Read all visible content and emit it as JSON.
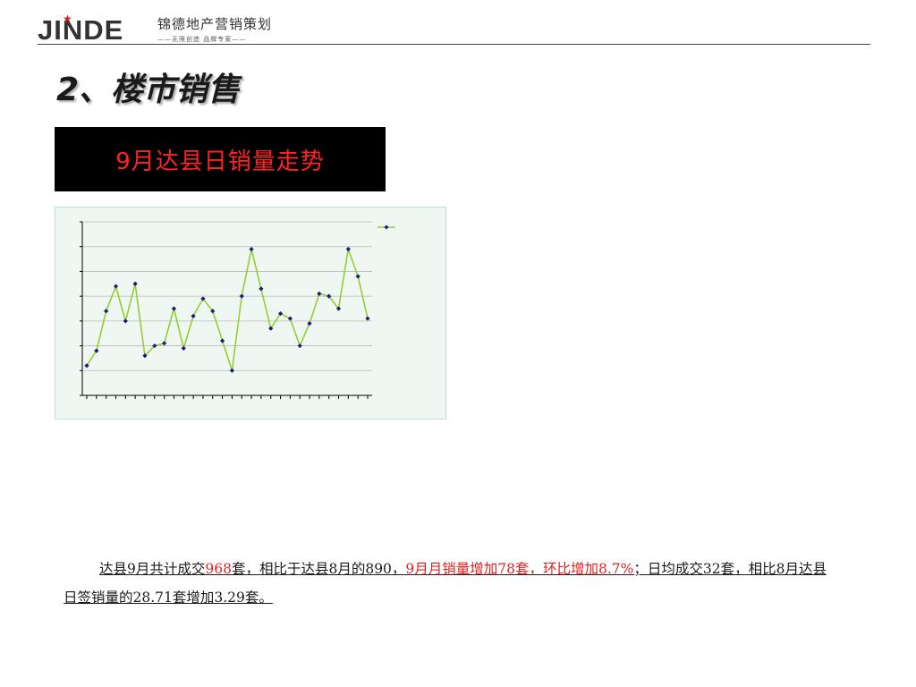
{
  "header": {
    "logo_wordmark": "JINDE",
    "company_name": "锦德地产营销策划",
    "slogan": "——无限创造 品牌专家——"
  },
  "slide": {
    "section_title": "2、楼市销售",
    "chart_title": "9月达县日销量走势"
  },
  "summary": {
    "part1": "达县9月共计成交",
    "total": "968",
    "part2": "套，相比于达县8月的890，",
    "highlight": "9月月销量增加78套，环比增加8.7%",
    "part3": "；日均成交32套，相比8月达县日签销量的28.71套增加3.29套。"
  },
  "colors": {
    "line": "#99cc33",
    "marker": "#1a1a80",
    "chart_background": "#eef7f2",
    "title_background": "#000000",
    "title_text": "#ff2323"
  },
  "chart_data": {
    "type": "line",
    "title": "9月达县日销量走势",
    "x": [
      1,
      2,
      3,
      4,
      5,
      6,
      7,
      8,
      9,
      10,
      11,
      12,
      13,
      14,
      15,
      16,
      17,
      18,
      19,
      20,
      21,
      22,
      23,
      24,
      25,
      26,
      27,
      28,
      29,
      30
    ],
    "series": [
      {
        "values": [
          12,
          18,
          34,
          44,
          30,
          45,
          16,
          20,
          21,
          35,
          19,
          32,
          39,
          34,
          22,
          10,
          40,
          59,
          43,
          27,
          33,
          31,
          20,
          29,
          41,
          40,
          35,
          59,
          48,
          31
        ]
      }
    ],
    "ylim": [
      0,
      70
    ],
    "xlabel": "",
    "ylabel": "",
    "grid": true,
    "legend": "top-right"
  }
}
